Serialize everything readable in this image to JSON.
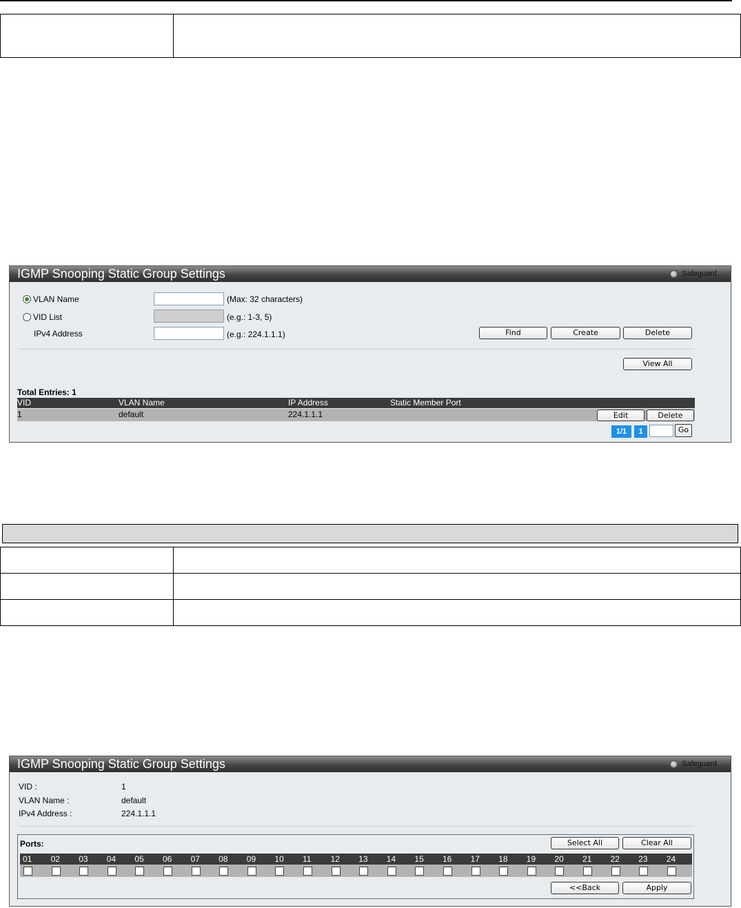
{
  "panel1": {
    "title": "IGMP Snooping Static Group Settings",
    "safeguard": "Safeguard",
    "form": {
      "vlan_name_label": "VLAN Name",
      "vlan_name_value": "",
      "vlan_name_hint": "(Max: 32 characters)",
      "vid_list_label": "VID List",
      "vid_list_hint": "(e.g.: 1-3, 5)",
      "ipv4_label": "IPv4 Address",
      "ipv4_value": "",
      "ipv4_hint": "(e.g.: 224.1.1.1)",
      "selected_radio": "VLAN Name"
    },
    "buttons": {
      "find": "Find",
      "create": "Create",
      "delete": "Delete",
      "view_all": "View All"
    },
    "total_entries": "Total Entries: 1",
    "table": {
      "columns": [
        "VID",
        "VLAN Name",
        "IP Address",
        "Static Member Port"
      ],
      "rows": [
        {
          "vid": "1",
          "vlan_name": "default",
          "ip": "224.1.1.1",
          "ports": "",
          "edit": "Edit",
          "delete": "Delete"
        }
      ]
    },
    "pager": {
      "page_of": "1/1",
      "current": "1",
      "go": "Go"
    }
  },
  "panel2": {
    "title": "IGMP Snooping Static Group Settings",
    "safeguard": "Safeguard",
    "info": [
      {
        "label": "VID :",
        "value": "1"
      },
      {
        "label": "VLAN Name :",
        "value": "default"
      },
      {
        "label": "IPv4 Address :",
        "value": "224.1.1.1"
      }
    ],
    "ports_label": "Ports:",
    "buttons": {
      "select_all": "Select All",
      "clear_all": "Clear All",
      "back": "<<Back",
      "apply": "Apply"
    },
    "ports": [
      "01",
      "02",
      "03",
      "04",
      "05",
      "06",
      "07",
      "08",
      "09",
      "10",
      "11",
      "12",
      "13",
      "14",
      "15",
      "16",
      "17",
      "18",
      "19",
      "20",
      "21",
      "22",
      "23",
      "24"
    ],
    "checked": []
  },
  "colors": {
    "title_bar": "#3b3b3b",
    "panel_bg": "#e8ecef",
    "pager_blue": "#1e90e6"
  }
}
